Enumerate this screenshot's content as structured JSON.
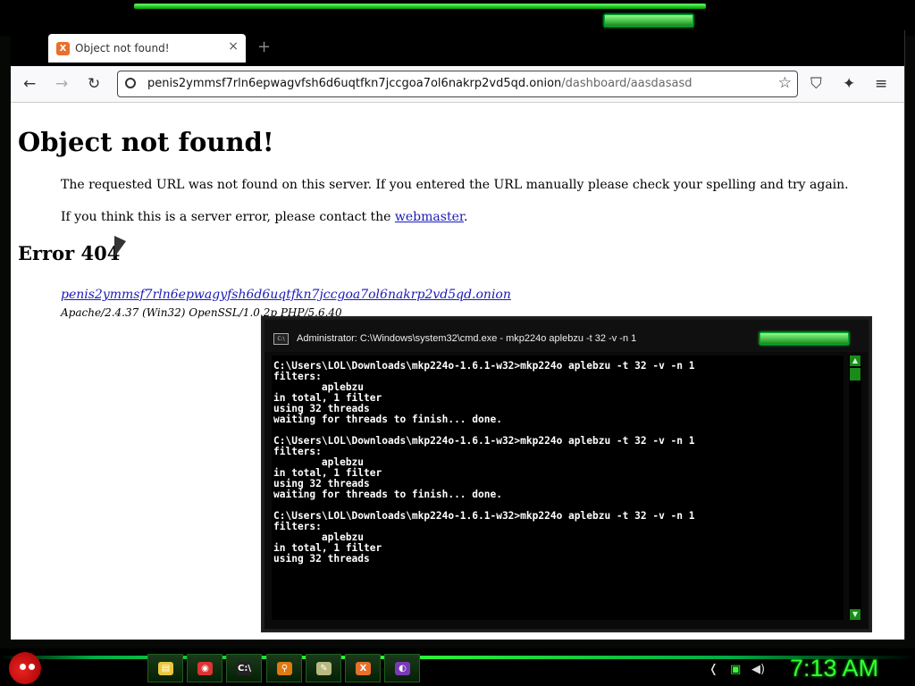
{
  "browser": {
    "tab": {
      "title": "Object not found!",
      "close": "×",
      "favicon_label": "X"
    },
    "newtab": "+",
    "nav": {
      "back": "←",
      "forward": "→",
      "reload": "↻"
    },
    "url": {
      "host": "penis2ymmsf7rln6epwagvfsh6d6uqtfkn7jccgoa7ol6nakrp2vd5qd.onion",
      "path": "/dashboard/aasdasasd"
    },
    "toolbar": {
      "star": "☆",
      "shield": "⛉",
      "extensions": "✦",
      "menu": "≡"
    }
  },
  "page": {
    "heading": "Object not found!",
    "para1": "The requested URL was not found on this server. If you entered the URL manually please check your spelling and try again.",
    "para2_prefix": "If you think this is a server error, please contact the ",
    "para2_link": "webmaster",
    "para2_suffix": ".",
    "error_heading": "Error 404",
    "server_address": "penis2ymmsf7rln6epwagyfsh6d6uqtfkn7jccgoa7ol6nakrp2vd5qd.onion",
    "server_signature": "Apache/2.4.37 (Win32) OpenSSL/1.0.2p PHP/5.6.40"
  },
  "cmd": {
    "title": "Administrator: C:\\Windows\\system32\\cmd.exe - mkp224o  aplebzu -t 32 -v -n 1",
    "icon_label": "C:\\",
    "lines": [
      "C:\\Users\\LOL\\Downloads\\mkp224o-1.6.1-w32>mkp224o aplebzu -t 32 -v -n 1",
      "filters:",
      "        aplebzu",
      "in total, 1 filter",
      "using 32 threads",
      "waiting for threads to finish... done.",
      "",
      "C:\\Users\\LOL\\Downloads\\mkp224o-1.6.1-w32>mkp224o aplebzu -t 32 -v -n 1",
      "filters:",
      "        aplebzu",
      "in total, 1 filter",
      "using 32 threads",
      "waiting for threads to finish... done.",
      "",
      "C:\\Users\\LOL\\Downloads\\mkp224o-1.6.1-w32>mkp224o aplebzu -t 32 -v -n 1",
      "filters:",
      "        aplebzu",
      "in total, 1 filter",
      "using 32 threads"
    ],
    "scroll_up": "▲",
    "scroll_down": "▼"
  },
  "taskbar": {
    "items": [
      {
        "icon": "folder-icon",
        "glyph": "▤",
        "color": "#e8c83a"
      },
      {
        "icon": "chrome-icon",
        "glyph": "◉",
        "color": "#d33"
      },
      {
        "icon": "cmd-icon",
        "glyph": "C:\\",
        "color": "#222"
      },
      {
        "icon": "search-icon",
        "glyph": "⚲",
        "color": "#e07a10"
      },
      {
        "icon": "notepad-icon",
        "glyph": "✎",
        "color": "#b8b880"
      },
      {
        "icon": "xampp-icon",
        "glyph": "X",
        "color": "#e8702a"
      },
      {
        "icon": "tor-icon",
        "glyph": "◐",
        "color": "#7a3ab8"
      }
    ],
    "clock": "7:13 AM",
    "tray": {
      "chevron": "❬",
      "network": "▣",
      "volume": "◀)"
    }
  }
}
